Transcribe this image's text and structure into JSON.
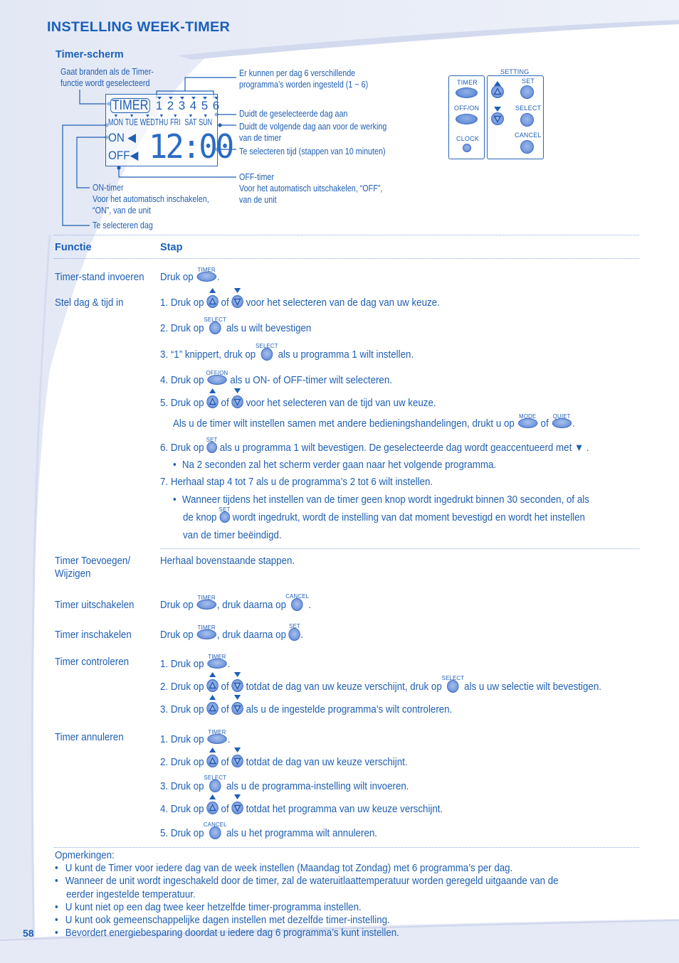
{
  "page": {
    "title": "INSTELLING WEEK-TIMER",
    "page_number": "58",
    "accent_color": "#1a5fb8"
  },
  "timer_screen": {
    "heading": "Timer-scherm",
    "lcd": {
      "timer_label": "TIMER",
      "programs": [
        "1",
        "2",
        "3",
        "4",
        "5",
        "6"
      ],
      "days": [
        "MON",
        "TUE",
        "WED",
        "THU",
        "FRI",
        "SAT",
        "SUN"
      ],
      "on_label": "ON",
      "off_label": "OFF",
      "time": "12:00"
    },
    "callouts": {
      "timer_lights": [
        "Gaat branden als de Timer-",
        "functie wordt geselecteerd"
      ],
      "programs": [
        "Er kunnen per dag 6 verschillende",
        "programma’s worden ingesteld (1 ~ 6)"
      ],
      "selected_day": "Duidt de geselecteerde dag aan",
      "next_day": [
        "Duidt de volgende dag aan voor de werking",
        "van de timer"
      ],
      "time_select": "Te selecteren tijd (stappen van 10 minuten)",
      "off_timer": [
        "OFF-timer",
        "Voor het automatisch uitschakelen, “OFF”,",
        "van de unit"
      ],
      "on_timer": [
        "ON-timer",
        "Voor het automatisch inschakelen,",
        "“ON”, van de unit"
      ],
      "select_day": "Te selecteren dag"
    }
  },
  "remote": {
    "setting_label": "SETTING",
    "buttons": {
      "timer": "TIMER",
      "off_on": "OFF/ON",
      "clock": "CLOCK",
      "set": "SET",
      "select": "SELECT",
      "cancel": "CANCEL"
    }
  },
  "table": {
    "header_function": "Functie",
    "header_step": "Stap",
    "icon_labels": {
      "timer": "TIMER",
      "select": "SELECT",
      "off_on": "OFF/ON",
      "mode": "MODE",
      "quiet": "QUIET",
      "set": "SET",
      "cancel": "CANCEL"
    },
    "rows": {
      "enter": {
        "function": "Timer-stand invoeren",
        "step_pre": "Druk op",
        "step_post": "."
      },
      "set_day_time": {
        "function": "Stel dag & tijd in",
        "s1_pre": "1. Druk op",
        "of": "of",
        "s1_post": "voor het selecteren van de dag van uw keuze.",
        "s2_pre": "2. Druk op",
        "s2_post": "als u wilt bevestigen",
        "s3_pre": "3. “1” knippert, druk op",
        "s3_post": "als u programma 1 wilt instellen.",
        "s4_pre": "4. Druk op",
        "s4_post": "als u ON- of OFF-timer wilt selecteren.",
        "s5_pre": "5. Druk op",
        "s5_post": "voor het selecteren van de tijd van uw keuze.",
        "s5_note_pre": "Als u de timer wilt instellen samen met andere bedieningshandelingen, drukt u op",
        "s5_note_post": ".",
        "s6_pre": "6. Druk op",
        "s6_post": "als u programma 1 wilt bevestigen. De geselecteerde dag wordt geaccentueerd met ▼ .",
        "s6_bullet": "Na 2 seconden zal het scherm verder gaan naar het volgende programma.",
        "s7": "7. Herhaal stap 4 tot 7 als u de programma’s 2 tot 6 wilt instellen.",
        "s7_bullet_line1": "Wanneer tijdens het instellen van de timer geen knop wordt ingedrukt binnen 30 seconden, of als",
        "s7_bullet_line2_pre": "de knop",
        "s7_bullet_line2_post": "wordt ingedrukt, wordt de instelling van dat moment bevestigd en wordt het instellen",
        "s7_bullet_line3": "van de timer beëindigd."
      },
      "add_change": {
        "function_line1": "Timer Toevoegen/",
        "function_line2": "Wijzigen",
        "step": "Herhaal bovenstaande stappen."
      },
      "disable": {
        "function": "Timer uitschakelen",
        "pre": "Druk op",
        "mid": ", druk daarna op",
        "post": "."
      },
      "enable": {
        "function": "Timer inschakelen",
        "pre": "Druk op",
        "mid": ", druk daarna op",
        "post": "."
      },
      "check": {
        "function": "Timer controleren",
        "s1_pre": "1. Druk op",
        "s1_post": ".",
        "s2_pre": "2. Druk op",
        "of": "of",
        "s2_mid": "totdat de dag van uw keuze verschijnt, druk op",
        "s2_post": "als u uw selectie wilt bevestigen.",
        "s3_pre": "3. Druk op",
        "s3_post": "als u de ingestelde programma’s wilt controleren."
      },
      "cancel": {
        "function": "Timer annuleren",
        "s1_pre": "1. Druk op",
        "s1_post": ".",
        "s2_pre": "2. Druk op",
        "of": "of",
        "s2_post": "totdat de dag van uw keuze verschijnt.",
        "s3_pre": "3. Druk op",
        "s3_post": "als u de programma-instelling wilt invoeren.",
        "s4_pre": "4. Druk op",
        "s4_post": "totdat het programma van uw keuze verschijnt.",
        "s5_pre": "5. Druk op",
        "s5_post": "als u het programma wilt annuleren."
      }
    }
  },
  "notes": {
    "heading": "Opmerkingen:",
    "items": [
      "U kunt de Timer voor iedere dag van de week instellen (Maandag tot Zondag) met 6 programma’s per dag.",
      "Wanneer de unit wordt ingeschakeld door de timer, zal de wateruitlaattemperatuur worden geregeld uitgaande van de",
      "eerder ingestelde temperatuur.",
      "U kunt niet op een dag twee keer hetzelfde timer-programma instellen.",
      "U kunt ook gemeenschappelijke dagen instellen met dezelfde timer-instelling.",
      "Bevordert energiebesparing doordat u iedere dag 6 programma’s kunt instellen."
    ]
  }
}
